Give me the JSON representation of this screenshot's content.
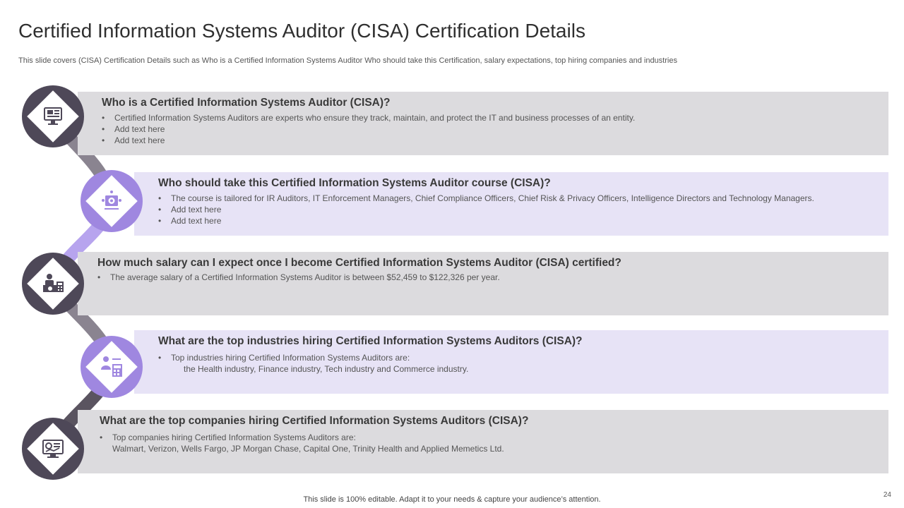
{
  "slide": {
    "title": "Certified Information Systems Auditor (CISA) Certification Details",
    "subtitle": "This slide covers (CISA) Certification Details such as Who is a Certified Information Systems Auditor Who should take this Certification, salary expectations,  top hiring companies and industries",
    "footer": "This slide is 100% editable. Adapt it to your needs & capture your audience’s attention.",
    "page_number": "24"
  },
  "sections": [
    {
      "heading": "Who is a Certified Information Systems Auditor (CISA)?",
      "bullets": [
        "Certified Information  Systems Auditors are experts who ensure they track, maintain, and protect the IT and business processes of an entity.",
        "Add text here",
        "Add text here"
      ],
      "icon": "computer-monitor-icon"
    },
    {
      "heading": "Who should take this Certified Information Systems Auditor course (CISA)?",
      "bullets": [
        "The course is tailored for IR Auditors, IT Enforcement Managers, Chief Compliance Officers, Chief Risk & Privacy Officers, Intelligence Directors and Technology Managers.",
        "Add text here",
        "Add text here"
      ],
      "icon": "gear-network-icon"
    },
    {
      "heading": "How much salary can I expect once I become Certified Information Systems Auditor (CISA) certified?",
      "bullets": [
        "The average  salary of a Certified Information  Systems Auditor is between $52,459 to $122,326 per year."
      ],
      "icon": "accountant-desk-icon"
    },
    {
      "heading": "What are the top industries hiring Certified Information Systems Auditors (CISA)?",
      "bullets": [
        "Top industries hiring Certified Information  Systems Auditors are:"
      ],
      "continuation": "the Health industry, Finance industry, Tech industry and Commerce industry.",
      "icon": "person-calculator-icon"
    },
    {
      "heading": "What are the top companies hiring Certified Information Systems Auditors (CISA)?",
      "bullets": [
        "Top companies hiring Certified Information  Systems Auditors are:"
      ],
      "continuation": "Walmart, Verizon, Wells Fargo, JP Morgan Chase, Capital One, Trinity Health and Applied Memetics Ltd.",
      "icon": "dashboard-monitor-icon"
    }
  ],
  "bullet_char": "•",
  "colors": {
    "dark_node": "#4e4858",
    "purple_node": "#9f87e0",
    "grey_band": "#dcdbde",
    "lavender_band": "#e7e3f6"
  }
}
